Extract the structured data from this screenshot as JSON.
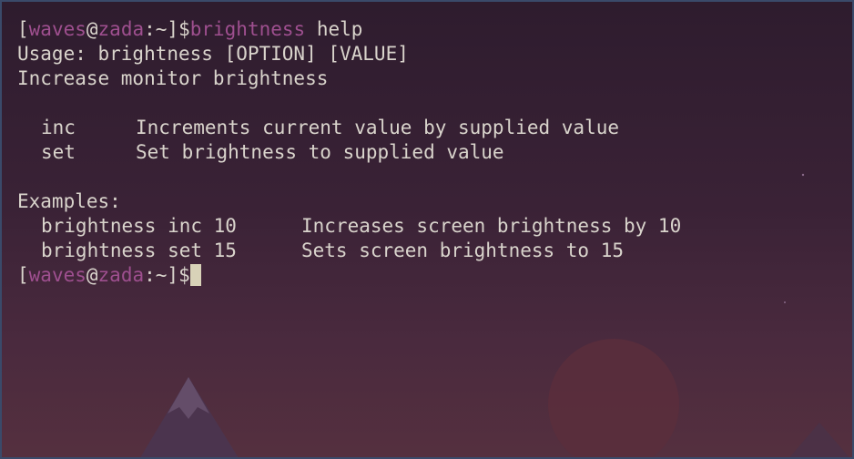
{
  "prompt1": {
    "open_bracket": "[",
    "user": "waves",
    "at": "@",
    "host": "zada",
    "colon": ":",
    "path": "~",
    "close_bracket": "]",
    "dollar": "$",
    "command": "brightness",
    "argument": " help"
  },
  "output": {
    "usage": "Usage: brightness [OPTION] [VALUE]",
    "description": "Increase monitor brightness",
    "options": [
      {
        "key": "inc",
        "desc": "Increments current value by supplied value"
      },
      {
        "key": "set",
        "desc": "Set brightness to supplied value"
      }
    ],
    "examples_header": "Examples:",
    "examples": [
      {
        "cmd": "brightness inc 10",
        "desc": "Increases screen brightness by 10"
      },
      {
        "cmd": "brightness set 15",
        "desc": "Sets screen brightness to 15"
      }
    ]
  },
  "prompt2": {
    "open_bracket": "[",
    "user": "waves",
    "at": "@",
    "host": "zada",
    "colon": ":",
    "path": "~",
    "close_bracket": "]",
    "dollar": "$"
  },
  "colors": {
    "background": "#2e1c2e",
    "text": "#d9d4cc",
    "accent": "#9e4f8f",
    "cursor": "#d8d2b8",
    "border": "#3a4a6a"
  }
}
